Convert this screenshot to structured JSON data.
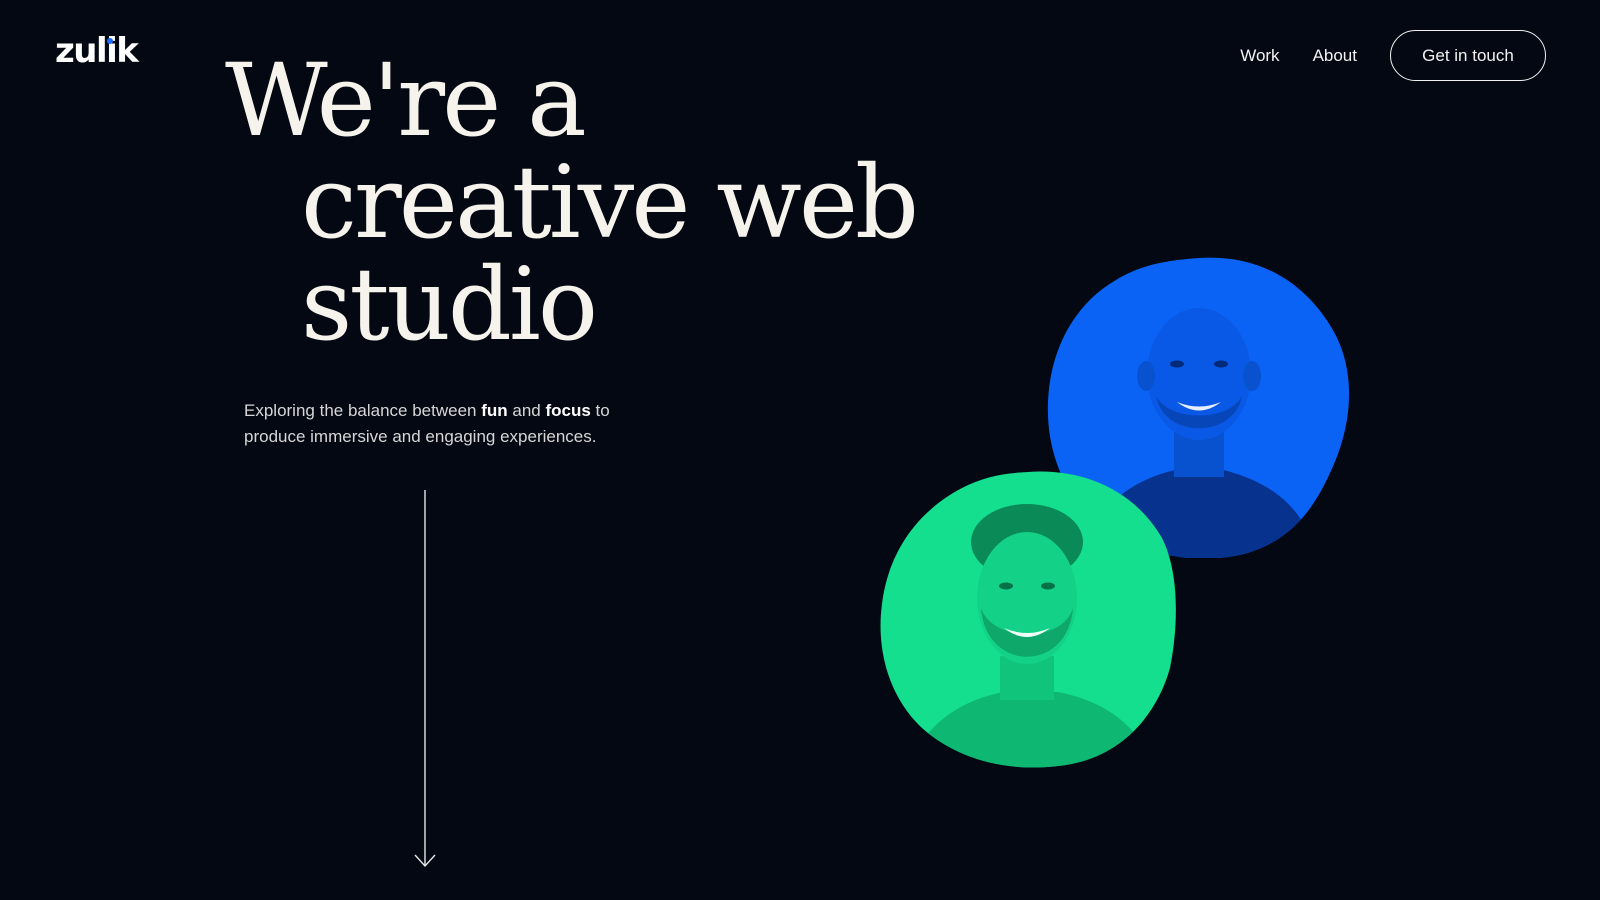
{
  "header": {
    "logo_text": "zulik",
    "nav": [
      {
        "label": "Work"
      },
      {
        "label": "About"
      }
    ],
    "cta_label": "Get in touch"
  },
  "hero": {
    "headline_lines": [
      "We're a",
      "creative web",
      "studio"
    ],
    "tagline": {
      "part1": "Exploring the balance between ",
      "strong1": "fun",
      "part2": " and ",
      "strong2": "focus",
      "part3": " to produce immersive and engaging experiences."
    }
  },
  "colors": {
    "background": "#040812",
    "text": "#f6f3ec",
    "accent_blue": "#0a63f5",
    "accent_green": "#14df8f",
    "logo_dot": "#1d6bff"
  },
  "icons": {
    "scroll": "arrow-down-icon"
  },
  "portraits": [
    {
      "name": "team-member-portrait-blue",
      "tint": "#0a63f5"
    },
    {
      "name": "team-member-portrait-green",
      "tint": "#14df8f"
    }
  ]
}
